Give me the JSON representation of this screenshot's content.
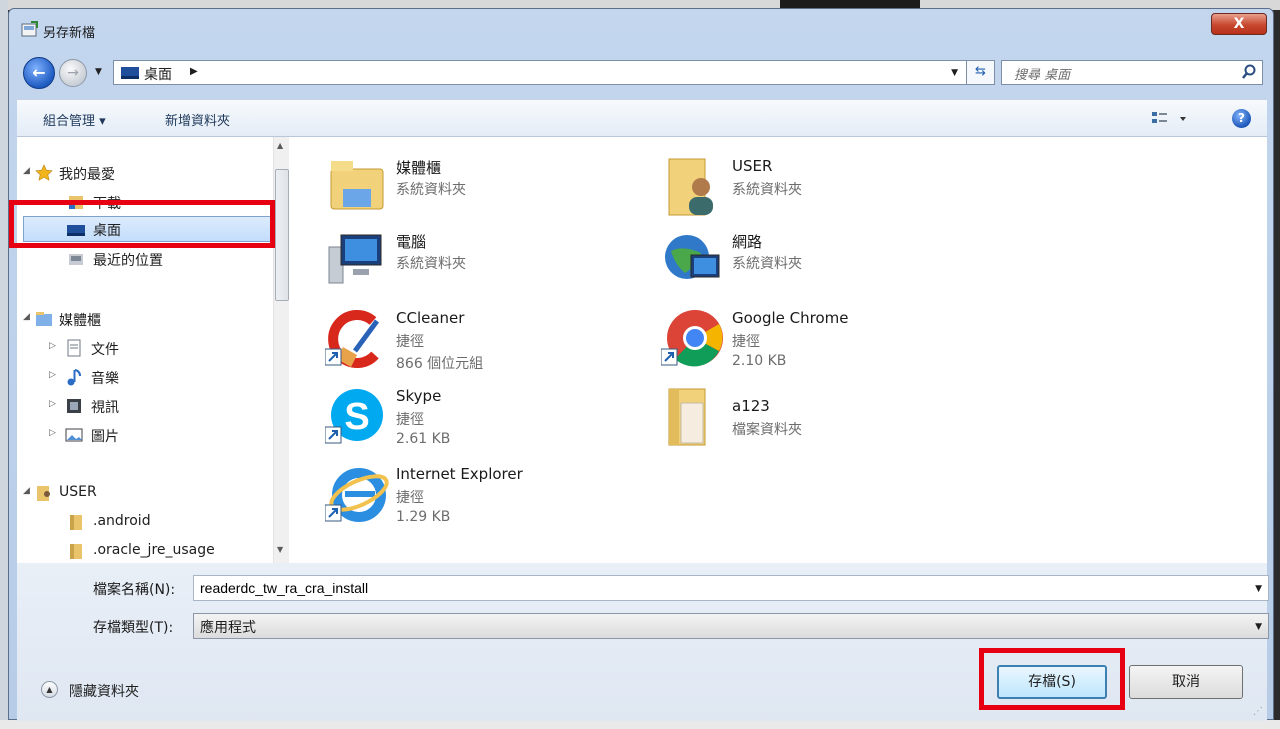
{
  "window": {
    "title": "另存新檔",
    "close_label": "X"
  },
  "address": {
    "location": "桌面",
    "search_placeholder": "搜尋 桌面"
  },
  "toolbar": {
    "organize": "組合管理 ▾",
    "new_folder": "新增資料夾",
    "help": "?"
  },
  "nav": {
    "favorites": "我的最愛",
    "downloads": "下載",
    "desktop": "桌面",
    "recent": "最近的位置",
    "libraries": "媒體櫃",
    "documents": "文件",
    "music": "音樂",
    "videos": "視訊",
    "pictures": "圖片",
    "user": "USER",
    "android": ".android",
    "oracle": ".oracle_jre_usage"
  },
  "items": [
    {
      "name": "媒體櫃",
      "line2": "系統資料夾",
      "line3": "",
      "icon": "libraries-icon"
    },
    {
      "name": "USER",
      "line2": "系統資料夾",
      "line3": "",
      "icon": "user-folder-icon"
    },
    {
      "name": "電腦",
      "line2": "系統資料夾",
      "line3": "",
      "icon": "computer-icon"
    },
    {
      "name": "網路",
      "line2": "系統資料夾",
      "line3": "",
      "icon": "network-icon"
    },
    {
      "name": "CCleaner",
      "line2": "捷徑",
      "line3": "866 個位元組",
      "icon": "ccleaner-icon"
    },
    {
      "name": "Google Chrome",
      "line2": "捷徑",
      "line3": "2.10 KB",
      "icon": "chrome-icon"
    },
    {
      "name": "Skype",
      "line2": "捷徑",
      "line3": "2.61 KB",
      "icon": "skype-icon"
    },
    {
      "name": "a123",
      "line2": "檔案資料夾",
      "line3": "",
      "icon": "folder-icon"
    },
    {
      "name": "Internet Explorer",
      "line2": "捷徑",
      "line3": "1.29 KB",
      "icon": "ie-icon"
    }
  ],
  "form": {
    "filename_label": "檔案名稱(N):",
    "filename_value": "readerdc_tw_ra_cra_install",
    "filetype_label": "存檔類型(T):",
    "filetype_value": "應用程式",
    "hide_folders": "隱藏資料夾",
    "save": "存檔(S)",
    "cancel": "取消"
  },
  "colors": {
    "highlight": "#e60012",
    "accent": "#1e5fb0"
  }
}
